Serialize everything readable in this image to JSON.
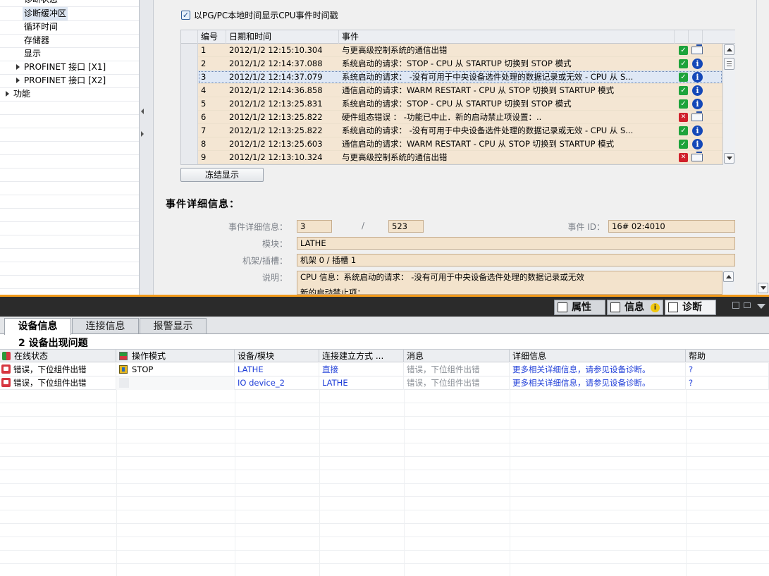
{
  "tree": {
    "items": [
      "诊断状态",
      "诊断缓冲区",
      "循环时间",
      "存储器",
      "显示",
      "PROFINET 接口 [X1]",
      "PROFINET 接口 [X2]",
      "功能"
    ]
  },
  "main": {
    "checkbox_label": "以PG/PC本地时间显示CPU事件时间戳",
    "headers": {
      "no": "编号",
      "datetime": "日期和时间",
      "event": "事件"
    },
    "events": [
      {
        "no": "1",
        "dt": "2012/1/2 12:15:10.304",
        "ev": "与更高级控制系统的通信出错",
        "status": "ok",
        "type": "mail"
      },
      {
        "no": "2",
        "dt": "2012/1/2 12:14:37.088",
        "ev": "系统启动的请求：STOP - CPU 从 STARTUP 切换到 STOP 模式",
        "status": "ok",
        "type": "info"
      },
      {
        "no": "3",
        "dt": "2012/1/2 12:14:37.079",
        "ev": "系统启动的请求： -没有可用于中央设备选件处理的数据记录或无效 - CPU 从 S...",
        "status": "ok",
        "type": "info"
      },
      {
        "no": "4",
        "dt": "2012/1/2 12:14:36.858",
        "ev": "通信启动的请求：WARM RESTART - CPU 从 STOP 切换到 STARTUP 模式",
        "status": "ok",
        "type": "info"
      },
      {
        "no": "5",
        "dt": "2012/1/2 12:13:25.831",
        "ev": "系统启动的请求：STOP - CPU 从 STARTUP 切换到 STOP 模式",
        "status": "ok",
        "type": "info"
      },
      {
        "no": "6",
        "dt": "2012/1/2 12:13:25.822",
        "ev": "硬件组态错误 ： -功能已中止．新的启动禁止项设置：..",
        "status": "warn",
        "type": "mail"
      },
      {
        "no": "7",
        "dt": "2012/1/2 12:13:25.822",
        "ev": "系统启动的请求： -没有可用于中央设备选件处理的数据记录或无效 - CPU 从 S...",
        "status": "ok",
        "type": "info"
      },
      {
        "no": "8",
        "dt": "2012/1/2 12:13:25.603",
        "ev": "通信启动的请求：WARM RESTART - CPU 从 STOP 切换到 STARTUP 模式",
        "status": "ok",
        "type": "info"
      },
      {
        "no": "9",
        "dt": "2012/1/2 12:13:10.324",
        "ev": "与更高级控制系统的通信出错",
        "status": "warn",
        "type": "mail"
      }
    ],
    "freeze_button": "冻结显示",
    "details_title": "事件详细信息：",
    "details": {
      "detail_label": "事件详细信息：",
      "detail_value": "3",
      "slash": "/",
      "detail_total": "523",
      "event_id_label": "事件 ID：",
      "event_id_value": "16# 02:4010",
      "module_label": "模块：",
      "module_value": "LATHE",
      "rack_label": "机架/插槽：",
      "rack_value": "机架 0 / 插槽 1",
      "desc_label": "说明：",
      "desc_value": "CPU 信息：系统启动的请求： -没有可用于中央设备选件处理的数据记录或无效",
      "desc_value2": "新的启动禁止项："
    }
  },
  "bottom": {
    "tabs": {
      "properties": "属性",
      "info": "信息",
      "diagnostics": "诊断"
    },
    "subtabs": [
      "设备信息",
      "连接信息",
      "报警显示"
    ],
    "summary": "2 设备出现问题",
    "headers": [
      "在线状态",
      "操作模式",
      "设备/模块",
      "连接建立方式 ...",
      "消息",
      "详细信息",
      "帮助"
    ],
    "rows": [
      {
        "status": "错误，下位组件出错",
        "mode": "STOP",
        "device": "LATHE",
        "conn": "直接",
        "msg": "错误，下位组件出错",
        "detail": "更多相关详细信息，请参见设备诊断。",
        "help": "?"
      },
      {
        "status": "错误，下位组件出错",
        "mode": "",
        "device": "IO device_2",
        "conn": "LATHE",
        "msg": "错误，下位组件出错",
        "detail": "更多相关详细信息，请参见设备诊断。",
        "help": "?"
      }
    ]
  },
  "colors": {
    "accent": "#f29b1c",
    "row_bg": "#f4e6d3",
    "link": "#1f3ed8"
  }
}
